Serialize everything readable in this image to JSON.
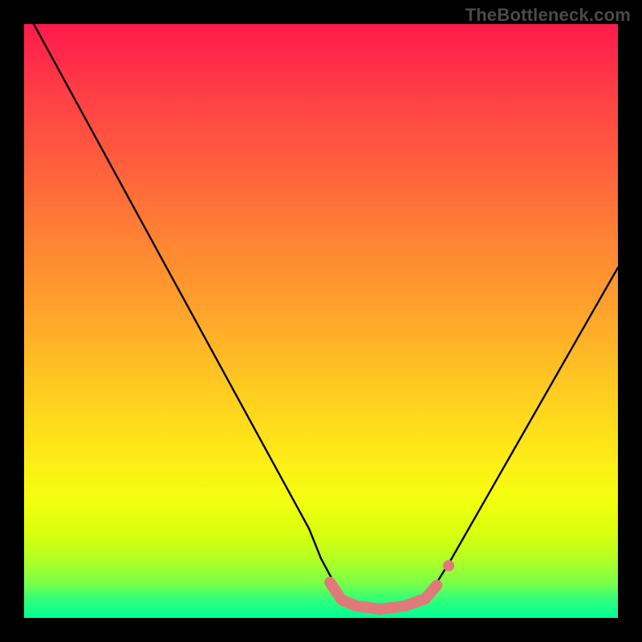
{
  "watermark": "TheBottleneck.com",
  "chart_data": {
    "type": "line",
    "title": "",
    "xlabel": "",
    "ylabel": "",
    "xlim": [
      0,
      1
    ],
    "ylim": [
      0,
      1
    ],
    "series": [
      {
        "name": "curve",
        "x": [
          0.0,
          0.06,
          0.12,
          0.18,
          0.24,
          0.3,
          0.36,
          0.42,
          0.48,
          0.5,
          0.535,
          0.55,
          0.58,
          0.62,
          0.66,
          0.68,
          0.72,
          0.78,
          0.84,
          0.9,
          0.96,
          1.0
        ],
        "values": [
          1.03,
          0.92,
          0.81,
          0.7,
          0.59,
          0.48,
          0.37,
          0.26,
          0.15,
          0.1,
          0.035,
          0.025,
          0.02,
          0.02,
          0.025,
          0.035,
          0.1,
          0.205,
          0.31,
          0.415,
          0.52,
          0.59
        ]
      },
      {
        "name": "highlight",
        "x": [
          0.515,
          0.535,
          0.56,
          0.6,
          0.64,
          0.675,
          0.695
        ],
        "values": [
          0.06,
          0.03,
          0.02,
          0.015,
          0.02,
          0.032,
          0.055
        ]
      },
      {
        "name": "highlight-dot",
        "x": [
          0.715
        ],
        "values": [
          0.088
        ]
      }
    ],
    "colors": {
      "curve": "#000000",
      "highlight": "#e07a7a",
      "gradient_top": "#ff1b4b",
      "gradient_bottom": "#00ff95"
    }
  }
}
